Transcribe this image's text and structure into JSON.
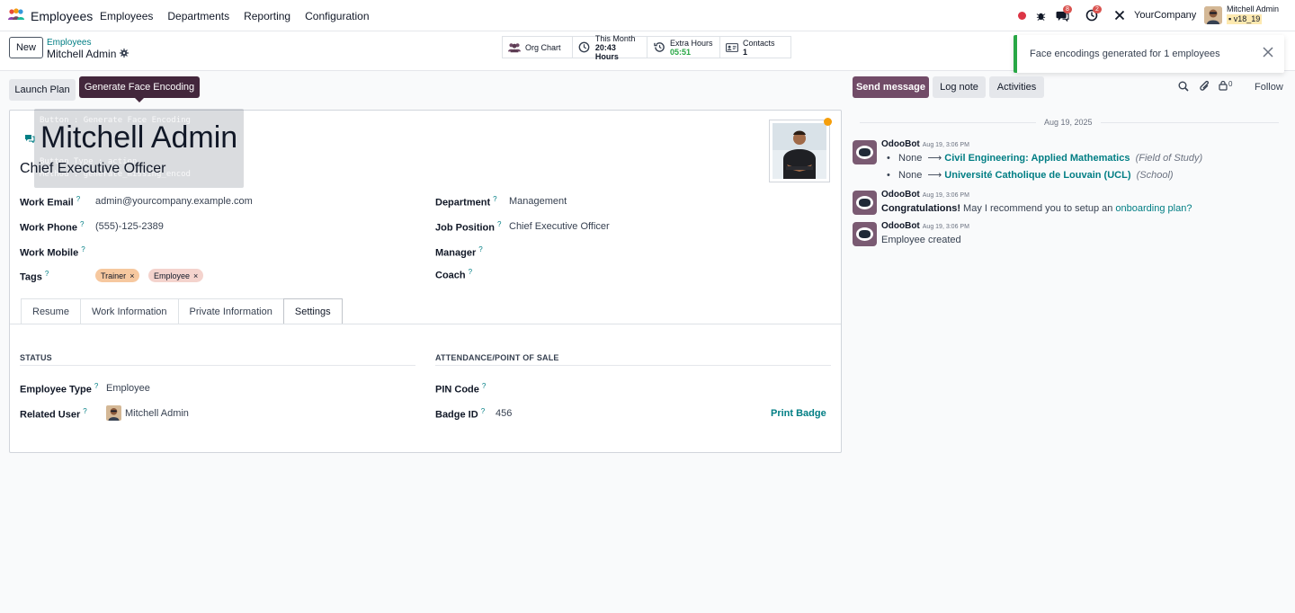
{
  "nav": {
    "app_title": "Employees",
    "menu": [
      "Employees",
      "Departments",
      "Reporting",
      "Configuration"
    ],
    "chat_count": "8",
    "activity_count": "2",
    "company": "YourCompany",
    "user_name": "Mitchell Admin",
    "db_name": "v18_19"
  },
  "control": {
    "new_label": "New",
    "breadcrumb_parent": "Employees",
    "breadcrumb_current": "Mitchell Admin",
    "smart_buttons": {
      "org_chart": "Org Chart",
      "this_month_label": "This Month",
      "this_month_value": "20:43 Hours",
      "extra_hours_label": "Extra Hours",
      "extra_hours_value": "05:51",
      "contacts_label": "Contacts",
      "contacts_value": "1"
    }
  },
  "toast": {
    "message": "Face encodings generated for 1 employees"
  },
  "actions": {
    "launch_plan": "Launch Plan",
    "tooltip": "Generate Face Encoding",
    "ghost_line1": "Button : Generate Face Encoding",
    "ghost_line2": "Button Type : action",
    "ghost_line3": "Method : generate_missing_encod"
  },
  "employee": {
    "name": "Mitchell Admin",
    "job_title": "Chief Executive Officer",
    "work_email_label": "Work Email",
    "work_email": "admin@yourcompany.example.com",
    "work_phone_label": "Work Phone",
    "work_phone": "(555)-125-2389",
    "work_mobile_label": "Work Mobile",
    "tags_label": "Tags",
    "tags": [
      "Trainer",
      "Employee"
    ],
    "department_label": "Department",
    "department": "Management",
    "job_position_label": "Job Position",
    "job_position": "Chief Executive Officer",
    "manager_label": "Manager",
    "coach_label": "Coach",
    "help_mark": "?",
    "tag_remove": "×"
  },
  "tabs": [
    "Resume",
    "Work Information",
    "Private Information",
    "Settings"
  ],
  "settings": {
    "status_title": "STATUS",
    "attendance_title": "ATTENDANCE/POINT OF SALE",
    "employee_type_label": "Employee Type",
    "employee_type": "Employee",
    "related_user_label": "Related User",
    "related_user": "Mitchell Admin",
    "pin_code_label": "PIN Code",
    "badge_id_label": "Badge ID",
    "badge_id": "456",
    "print_badge": "Print Badge"
  },
  "chatter": {
    "send_message": "Send message",
    "log_note": "Log note",
    "activities": "Activities",
    "followers_count": "0",
    "follow": "Follow",
    "date": "Aug 19, 2025",
    "messages": [
      {
        "author": "OdooBot",
        "time": "Aug 19, 3:06 PM",
        "changes": [
          {
            "old": "None",
            "new": "Civil Engineering: Applied Mathematics",
            "field": "(Field of Study)"
          },
          {
            "old": "None",
            "new": "Université Catholique de Louvain (UCL)",
            "field": "(School)"
          }
        ]
      },
      {
        "author": "OdooBot",
        "time": "Aug 19, 3:06 PM",
        "bold": "Congratulations!",
        "text": " May I recommend you to setup an ",
        "link": "onboarding plan?"
      },
      {
        "author": "OdooBot",
        "time": "Aug 19, 3:06 PM",
        "text": "Employee created"
      }
    ],
    "arrow": "⟶"
  },
  "colors": {
    "brand": "#714b67",
    "link": "#017e84",
    "success": "#28a745",
    "tag_trainer": "#f6c89f",
    "tag_employee": "#f4d3cd"
  }
}
